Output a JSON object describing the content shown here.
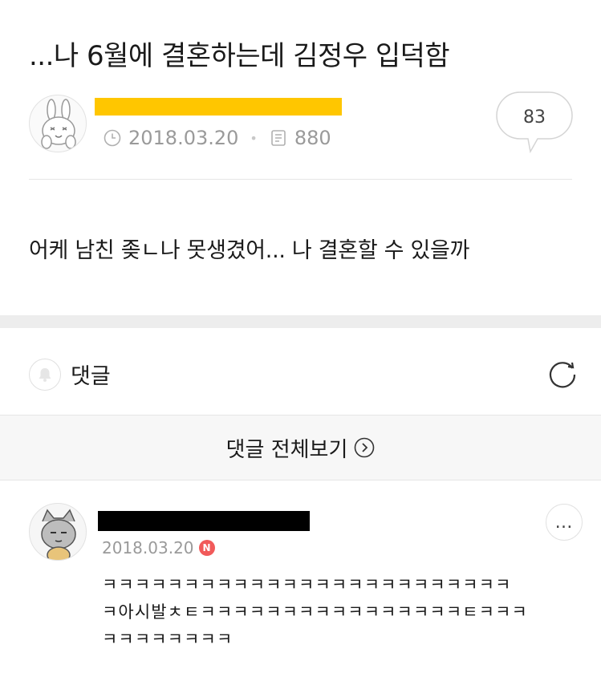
{
  "post": {
    "title": "...나 6월에 결혼하는데 김정우 입덕함",
    "date": "2018.03.20",
    "views": "880",
    "comment_count": "83",
    "body": "어케 남친 좆ㄴ나 못생겼어... 나 결혼할 수 있을까"
  },
  "comments_section": {
    "header_label": "댓글",
    "view_all_label": "댓글 전체보기"
  },
  "comment": {
    "date": "2018.03.20",
    "new_badge": "N",
    "more_label": "…",
    "lines": [
      "ㅋㅋㅋㅋㅋㅋㅋㅋㅋㅋㅋㅋㅋㅋㅋㅋㅋㅋㅋㅋㅋㅋㅋㅋㅋ",
      "ㅋ아시발ㅊㅌㅋㅋㅋㅋㅋㅋㅋㅋㅋㅋㅋㅋㅋㅋㅋㅋㅌㅋㅋㅋ",
      "ㅋㅋㅋㅋㅋㅋㅋㅋ"
    ]
  },
  "colors": {
    "author_redaction": "#ffc600",
    "commenter_redaction": "#000000",
    "section_gap": "#ededed",
    "badge": "#f15a5a"
  },
  "icons": [
    "clock-icon",
    "document-icon",
    "speech-bubble-icon",
    "bell-icon",
    "refresh-icon",
    "chevron-right-circle-icon",
    "more-options-icon"
  ]
}
